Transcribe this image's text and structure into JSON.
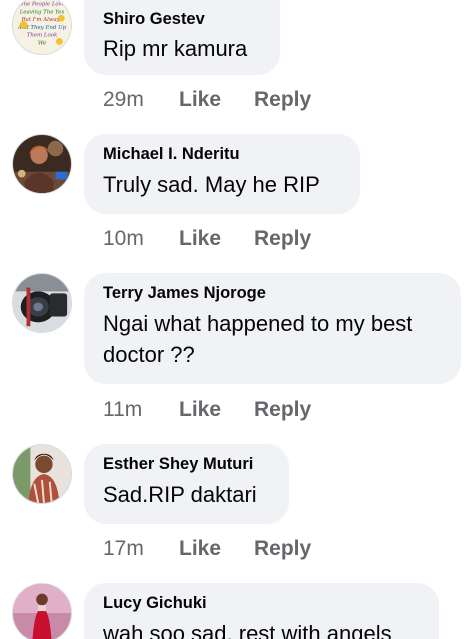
{
  "comments": [
    {
      "author": "Shiro Gestev",
      "text": "Rip mr kamura",
      "time": "29m",
      "like": "Like",
      "reply": "Reply",
      "avatar_icon": "text-collage-avatar",
      "avatar_lines": [
        "One People Love",
        "Leaving The Yes",
        "But I'm Always",
        "And They End Up",
        "Them Look",
        "We"
      ]
    },
    {
      "author": "Michael I. Nderitu",
      "text": "Truly sad. May he RIP",
      "time": "10m",
      "like": "Like",
      "reply": "Reply",
      "avatar_icon": "person-avatar"
    },
    {
      "author": "Terry James Njoroge",
      "text": "Ngai what happened to my best doctor ??",
      "time": "11m",
      "like": "Like",
      "reply": "Reply",
      "avatar_icon": "camera-lens-avatar"
    },
    {
      "author": "Esther Shey Muturi",
      "text": "Sad.RIP daktari",
      "time": "17m",
      "like": "Like",
      "reply": "Reply",
      "avatar_icon": "person-avatar"
    },
    {
      "author": "Lucy Gichuki",
      "text": "wah soo sad, rest with angels",
      "avatar_icon": "person-red-dress-avatar"
    }
  ]
}
